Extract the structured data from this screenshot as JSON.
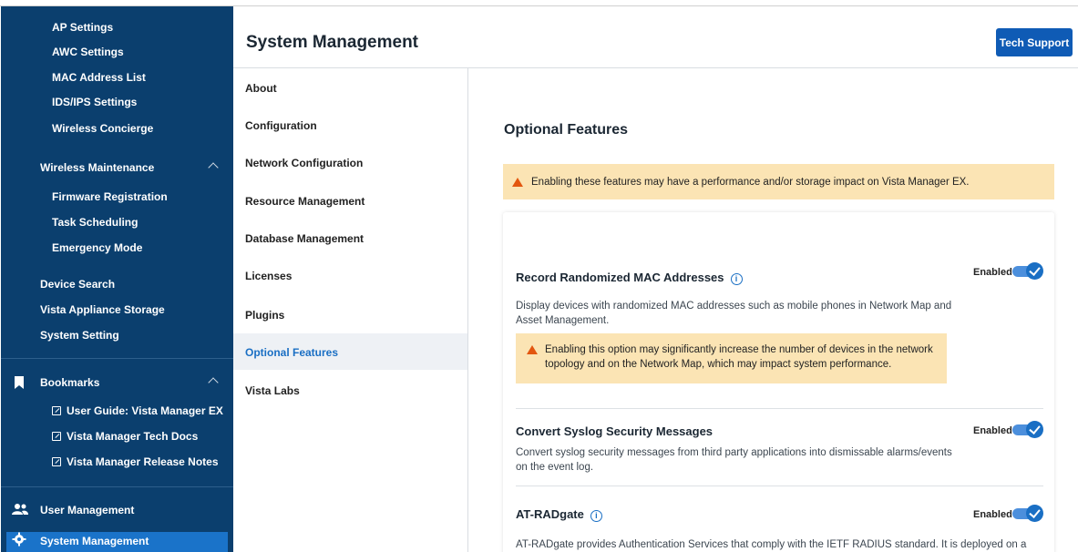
{
  "sidebar": {
    "wireless_settings_items": [
      "AP Settings",
      "AWC Settings",
      "MAC Address List",
      "IDS/IPS Settings",
      "Wireless Concierge"
    ],
    "wireless_maintenance": {
      "label": "Wireless Maintenance",
      "items": [
        "Firmware Registration",
        "Task Scheduling",
        "Emergency Mode"
      ]
    },
    "other_items": [
      "Device Search",
      "Vista Appliance Storage",
      "System Setting"
    ],
    "bookmarks": {
      "label": "Bookmarks",
      "items": [
        "User Guide: Vista Manager EX",
        "Vista Manager Tech Docs",
        "Vista Manager Release Notes"
      ]
    },
    "user_management": "User Management",
    "system_management": "System Management"
  },
  "header": {
    "title": "System Management",
    "tech_support": "Tech Support"
  },
  "subnav": {
    "items": [
      "About",
      "Configuration",
      "Network Configuration",
      "Resource Management",
      "Database Management",
      "Licenses",
      "Plugins",
      "Optional Features",
      "Vista Labs"
    ],
    "active": "Optional Features"
  },
  "content": {
    "title": "Optional Features",
    "banner": "Enabling these features may have a performance and/or storage impact on Vista Manager EX.",
    "features": [
      {
        "title": "Record Randomized MAC Addresses",
        "description": "Display devices with randomized MAC addresses such as mobile phones in Network Map and Asset Management.",
        "warning": "Enabling this option may significantly increase the number of devices in the network topology and on the Network Map, which may impact system performance.",
        "status": "Enabled",
        "enabled": true
      },
      {
        "title": "Convert Syslog Security Messages",
        "description": "Convert syslog security messages from third party applications into dismissable alarms/events on the event log.",
        "status": "Enabled",
        "enabled": true
      },
      {
        "title": "AT-RADgate",
        "description": "AT-RADgate provides Authentication Services that comply with the IETF RADIUS standard. It is deployed on a",
        "status": "Enabled",
        "enabled": true
      }
    ]
  },
  "colors": {
    "sidebar_bg": "#0b3f6e",
    "accent": "#1a6fc4",
    "warning_bg": "#fbe4b4",
    "warning_icon": "#e3560f"
  }
}
